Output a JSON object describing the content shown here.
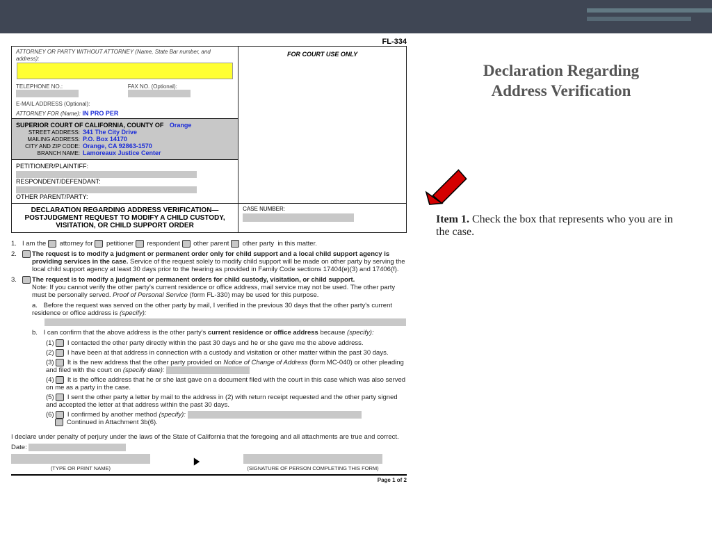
{
  "form_code": "FL-334",
  "header": {
    "attorney_label": "ATTORNEY OR PARTY WITHOUT ATTORNEY (Name, State Bar number, and address):",
    "court_use": "FOR COURT USE ONLY",
    "tel_label": "TELEPHONE NO.:",
    "fax_label": "FAX NO. (Optional):",
    "email_label": "E-MAIL ADDRESS (Optional):",
    "attorney_for_label": "ATTORNEY FOR (Name):",
    "attorney_for_value": "IN PRO PER",
    "court_title": "SUPERIOR COURT OF CALIFORNIA, COUNTY OF",
    "county_value": "Orange",
    "street_label": "STREET ADDRESS:",
    "street_value": "341 The City Drive",
    "mail_label": "MAILING ADDRESS:",
    "mail_value": "P.O. Box 14170",
    "city_label": "CITY AND ZIP CODE:",
    "city_value": "Orange, CA 92863-1570",
    "branch_label": "BRANCH NAME:",
    "branch_value": "Lamoreaux Justice Center",
    "petitioner_label": "PETITIONER/PLAINTIFF:",
    "respondent_label": "RESPONDENT/DEFENDANT:",
    "other_parent_label": "OTHER PARENT/PARTY:",
    "case_label": "CASE NUMBER:",
    "form_title_1": "DECLARATION REGARDING ADDRESS VERIFICATION—",
    "form_title_2": "POSTJUDGMENT REQUEST TO MODIFY A CHILD CUSTODY,",
    "form_title_3": "VISITATION, OR CHILD SUPPORT ORDER"
  },
  "items": {
    "i1_prefix": "1.",
    "i1_text": "I am the",
    "i1_opt_attorney": "attorney for",
    "i1_opt_petitioner": "petitioner",
    "i1_opt_respondent": "respondent",
    "i1_opt_other_parent": "other parent",
    "i1_opt_other_party": "other party",
    "i1_suffix": "in this matter.",
    "i2_prefix": "2.",
    "i2_bold": "The request is to modify a judgment or permanent order only for child support and a local child support agency is providing services in the case.",
    "i2_rest": " Service of the request solely to modify child support will be made on other party by serving the local child support agency at least 30 days prior to the hearing as provided in Family Code sections 17404(e)(3) and 17406(f).",
    "i3_prefix": "3.",
    "i3_bold": "The request is to modify a judgment or permanent orders for child custody, visitation, or child support.",
    "i3_note": "Note: If you cannot verify the other party's current residence or office address, mail service may not be used. The other party must be personally served.",
    "i3_note_italic": "Proof of Personal Service",
    "i3_note_tail": " (form FL-330) may be used for this purpose.",
    "i3a_lab": "a.",
    "i3a_text": "Before the request was served on the other party by mail, I verified in the previous 30 days that the other party's current residence or office address is ",
    "i3a_spec": "(specify):",
    "i3b_lab": "b.",
    "i3b_text": "I can confirm that the above address is the other party's",
    "i3b_bold": " current residence or office address ",
    "i3b_tail": "because ",
    "i3b_spec": "(specify):",
    "n1": "(1)",
    "n1_text": "I contacted the other party directly within the past 30 days and he or she gave me the above address.",
    "n2": "(2)",
    "n2_text": "I have been at that address in connection with a custody and visitation or other matter within the past 30 days.",
    "n3": "(3)",
    "n3_text1": "It is the new address that the other party provided on ",
    "n3_italic": "Notice of Change of Address",
    "n3_text2": " (form MC-040) or other pleading and filed with the court on ",
    "n3_spec": "(specify date):",
    "n4": "(4)",
    "n4_text": "It is the office address that he or she last gave on a document filed with the court in this case which was also served on me as a party in the case.",
    "n5": "(5)",
    "n5_text": "I sent the other party a letter by mail to the address in (2) with return receipt requested and the other party signed and accepted the letter at that address within the past 30 days.",
    "n6": "(6)",
    "n6_text": "I confirmed by another method ",
    "n6_spec": "(specify):",
    "n6_cont": "Continued in Attachment 3b(6).",
    "declare": "I declare under penalty of perjury under the laws of the State of California that the foregoing and all attachments are true and correct.",
    "date_label": "Date:",
    "type_caption": "(TYPE OR PRINT NAME)",
    "sig_caption": "(SIGNATURE OF PERSON COMPLETING THIS FORM)",
    "page": "Page 1 of 2"
  },
  "sidebar": {
    "title1": "Declaration Regarding",
    "title2": "Address Verification",
    "item1_label": "Item 1.",
    "item1_text": "  Check the box that represents who you are in the case."
  }
}
